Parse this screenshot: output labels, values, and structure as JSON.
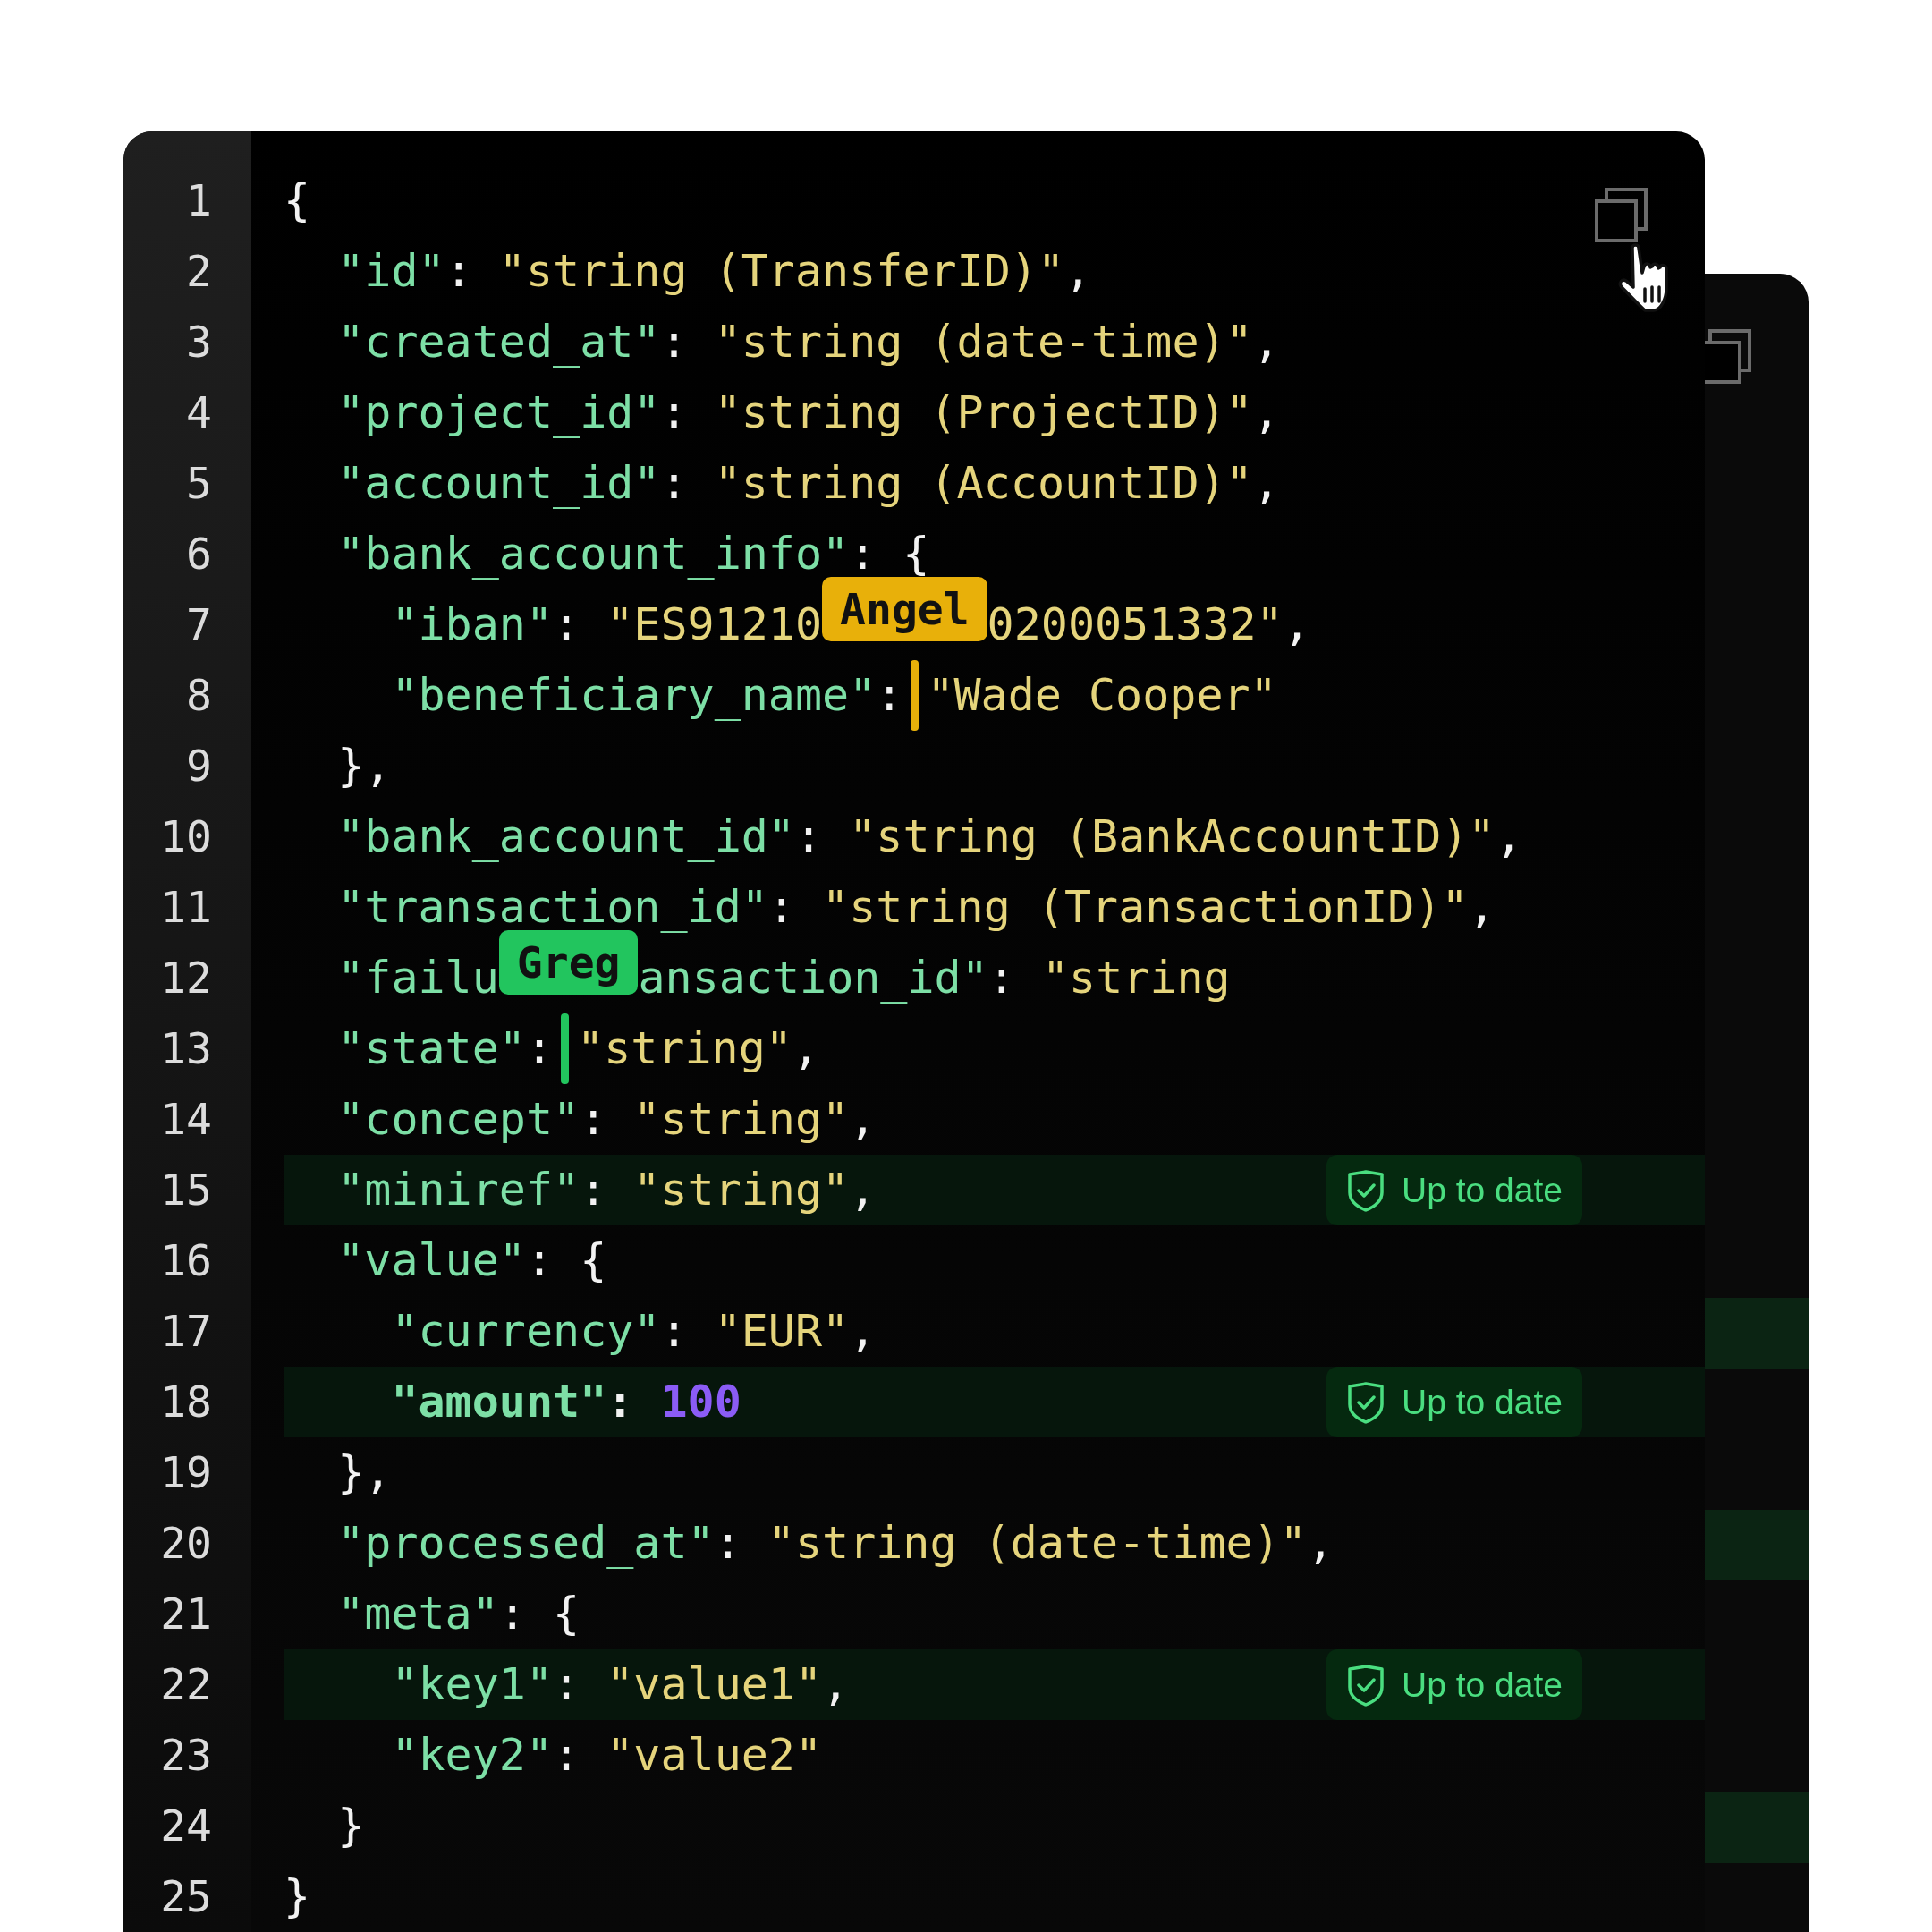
{
  "editor": {
    "lines": [
      {
        "number": "1",
        "highlighted": false,
        "emphasis": false,
        "tokens": [
          {
            "kind": "punct",
            "text": "{"
          }
        ]
      },
      {
        "number": "2",
        "highlighted": false,
        "emphasis": false,
        "tokens": [
          {
            "kind": "key",
            "text": "  \"id\""
          },
          {
            "kind": "punct",
            "text": ": "
          },
          {
            "kind": "string",
            "text": "\"string (TransferID)\""
          },
          {
            "kind": "punct",
            "text": ","
          }
        ]
      },
      {
        "number": "3",
        "highlighted": false,
        "emphasis": false,
        "tokens": [
          {
            "kind": "key",
            "text": "  \"created_at\""
          },
          {
            "kind": "punct",
            "text": ": "
          },
          {
            "kind": "string",
            "text": "\"string (date-time)\""
          },
          {
            "kind": "punct",
            "text": ","
          }
        ]
      },
      {
        "number": "4",
        "highlighted": false,
        "emphasis": false,
        "tokens": [
          {
            "kind": "key",
            "text": "  \"project_id\""
          },
          {
            "kind": "punct",
            "text": ": "
          },
          {
            "kind": "string",
            "text": "\"string (ProjectID)\""
          },
          {
            "kind": "punct",
            "text": ","
          }
        ]
      },
      {
        "number": "5",
        "highlighted": false,
        "emphasis": false,
        "tokens": [
          {
            "kind": "key",
            "text": "  \"account_id\""
          },
          {
            "kind": "punct",
            "text": ": "
          },
          {
            "kind": "string",
            "text": "\"string (AccountID)\""
          },
          {
            "kind": "punct",
            "text": ","
          }
        ]
      },
      {
        "number": "6",
        "highlighted": false,
        "emphasis": false,
        "tokens": [
          {
            "kind": "key",
            "text": "  \"bank_account_info\""
          },
          {
            "kind": "punct",
            "text": ": {"
          }
        ]
      },
      {
        "number": "7",
        "highlighted": false,
        "emphasis": false,
        "tokens": [
          {
            "kind": "key",
            "text": "    \"iban\""
          },
          {
            "kind": "punct",
            "text": ": "
          },
          {
            "kind": "string",
            "text": "\"ES91210"
          },
          {
            "kind": "label",
            "text": "Angel",
            "color": "#e8b00a"
          },
          {
            "kind": "string",
            "text": "0200051332\""
          },
          {
            "kind": "punct",
            "text": ","
          }
        ]
      },
      {
        "number": "8",
        "highlighted": false,
        "emphasis": false,
        "tokens": [
          {
            "kind": "key",
            "text": "    \"beneficiary_name\""
          },
          {
            "kind": "punct",
            "text": ":"
          },
          {
            "kind": "cursor",
            "color": "#e8b00a"
          },
          {
            "kind": "string",
            "text": "\"Wade Cooper\""
          }
        ]
      },
      {
        "number": "9",
        "highlighted": false,
        "emphasis": false,
        "tokens": [
          {
            "kind": "punct",
            "text": "  },"
          }
        ]
      },
      {
        "number": "10",
        "highlighted": false,
        "emphasis": false,
        "tokens": [
          {
            "kind": "key",
            "text": "  \"bank_account_id\""
          },
          {
            "kind": "punct",
            "text": ": "
          },
          {
            "kind": "string",
            "text": "\"string (BankAccountID)\""
          },
          {
            "kind": "punct",
            "text": ","
          }
        ]
      },
      {
        "number": "11",
        "highlighted": false,
        "emphasis": false,
        "tokens": [
          {
            "kind": "key",
            "text": "  \"transaction_id\""
          },
          {
            "kind": "punct",
            "text": ": "
          },
          {
            "kind": "string",
            "text": "\"string (TransactionID)\""
          },
          {
            "kind": "punct",
            "text": ","
          }
        ]
      },
      {
        "number": "12",
        "highlighted": false,
        "emphasis": false,
        "tokens": [
          {
            "kind": "key",
            "text": "  \"failu"
          },
          {
            "kind": "label",
            "text": "Greg",
            "color": "#22c55e"
          },
          {
            "kind": "key",
            "text": "ansaction_id\""
          },
          {
            "kind": "punct",
            "text": ": "
          },
          {
            "kind": "string",
            "text": "\"string"
          }
        ]
      },
      {
        "number": "13",
        "highlighted": false,
        "emphasis": false,
        "tokens": [
          {
            "kind": "key",
            "text": "  \"state\""
          },
          {
            "kind": "punct",
            "text": ":"
          },
          {
            "kind": "cursor",
            "color": "#22c55e"
          },
          {
            "kind": "string",
            "text": "\"string\""
          },
          {
            "kind": "punct",
            "text": ","
          }
        ]
      },
      {
        "number": "14",
        "highlighted": false,
        "emphasis": false,
        "tokens": [
          {
            "kind": "key",
            "text": "  \"concept\""
          },
          {
            "kind": "punct",
            "text": ": "
          },
          {
            "kind": "string",
            "text": "\"string\""
          },
          {
            "kind": "punct",
            "text": ","
          }
        ]
      },
      {
        "number": "15",
        "highlighted": true,
        "emphasis": false,
        "badge": "Up to date",
        "tokens": [
          {
            "kind": "key",
            "text": "  \"miniref\""
          },
          {
            "kind": "punct",
            "text": ": "
          },
          {
            "kind": "string",
            "text": "\"string\""
          },
          {
            "kind": "punct",
            "text": ","
          }
        ]
      },
      {
        "number": "16",
        "highlighted": false,
        "emphasis": false,
        "tokens": [
          {
            "kind": "key",
            "text": "  \"value\""
          },
          {
            "kind": "punct",
            "text": ": {"
          }
        ]
      },
      {
        "number": "17",
        "highlighted": false,
        "emphasis": false,
        "tokens": [
          {
            "kind": "key",
            "text": "    \"currency\""
          },
          {
            "kind": "punct",
            "text": ": "
          },
          {
            "kind": "string",
            "text": "\"EUR\""
          },
          {
            "kind": "punct",
            "text": ","
          }
        ]
      },
      {
        "number": "18",
        "highlighted": true,
        "emphasis": true,
        "badge": "Up to date",
        "tokens": [
          {
            "kind": "key",
            "text": "    \"amount\""
          },
          {
            "kind": "punct",
            "text": ": "
          },
          {
            "kind": "number",
            "text": "100"
          }
        ]
      },
      {
        "number": "19",
        "highlighted": false,
        "emphasis": false,
        "tokens": [
          {
            "kind": "punct",
            "text": "  },"
          }
        ]
      },
      {
        "number": "20",
        "highlighted": false,
        "emphasis": false,
        "tokens": [
          {
            "kind": "key",
            "text": "  \"processed_at\""
          },
          {
            "kind": "punct",
            "text": ": "
          },
          {
            "kind": "string",
            "text": "\"string (date-time)\""
          },
          {
            "kind": "punct",
            "text": ","
          }
        ]
      },
      {
        "number": "21",
        "highlighted": false,
        "emphasis": false,
        "tokens": [
          {
            "kind": "key",
            "text": "  \"meta\""
          },
          {
            "kind": "punct",
            "text": ": {"
          }
        ]
      },
      {
        "number": "22",
        "highlighted": true,
        "emphasis": false,
        "badge": "Up to date",
        "tokens": [
          {
            "kind": "key",
            "text": "    \"key1\""
          },
          {
            "kind": "punct",
            "text": ": "
          },
          {
            "kind": "string",
            "text": "\"value1\""
          },
          {
            "kind": "punct",
            "text": ","
          }
        ]
      },
      {
        "number": "23",
        "highlighted": false,
        "emphasis": false,
        "tokens": [
          {
            "kind": "key",
            "text": "    \"key2\""
          },
          {
            "kind": "punct",
            "text": ": "
          },
          {
            "kind": "string",
            "text": "\"value2\""
          }
        ]
      },
      {
        "number": "24",
        "highlighted": false,
        "emphasis": false,
        "tokens": [
          {
            "kind": "punct",
            "text": "  }"
          }
        ]
      },
      {
        "number": "25",
        "highlighted": false,
        "emphasis": false,
        "tokens": [
          {
            "kind": "punct",
            "text": "}"
          }
        ]
      }
    ]
  },
  "back_card": {
    "rows": [
      {
        "highlighted": false
      },
      {
        "highlighted": false
      },
      {
        "highlighted": false
      },
      {
        "highlighted": false
      },
      {
        "highlighted": false
      },
      {
        "highlighted": false
      },
      {
        "highlighted": false
      },
      {
        "highlighted": false
      },
      {
        "highlighted": false
      },
      {
        "highlighted": false
      },
      {
        "highlighted": false
      },
      {
        "highlighted": false
      },
      {
        "highlighted": false
      },
      {
        "highlighted": false
      },
      {
        "highlighted": true
      },
      {
        "highlighted": false
      },
      {
        "highlighted": false
      },
      {
        "highlighted": true
      },
      {
        "highlighted": false
      },
      {
        "highlighted": false
      },
      {
        "highlighted": false
      },
      {
        "highlighted": true
      },
      {
        "highlighted": false
      }
    ]
  }
}
